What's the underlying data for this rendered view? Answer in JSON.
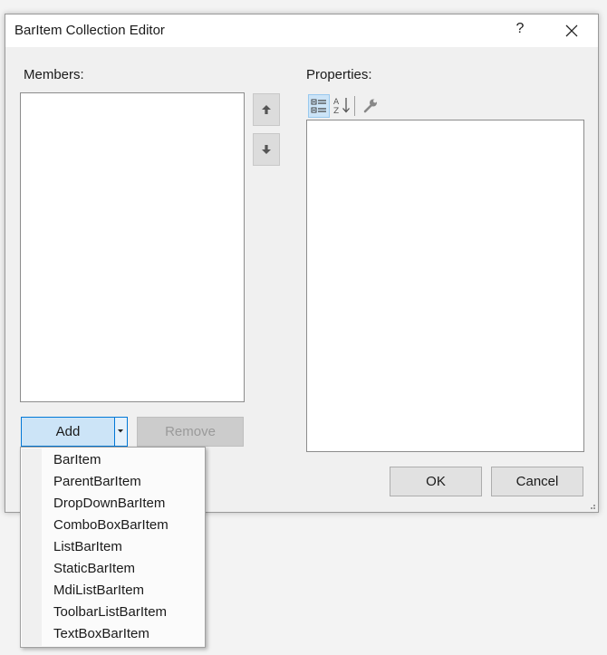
{
  "window": {
    "title": "BarItem Collection Editor",
    "help": "?",
    "close_icon": "close-icon"
  },
  "members": {
    "label": "Members:",
    "items": []
  },
  "properties": {
    "label": "Properties:"
  },
  "toolbar": {
    "buttons": [
      {
        "icon": "categorized-icon",
        "active": true
      },
      {
        "icon": "alphabetical-icon",
        "active": false
      },
      {
        "icon": "wrench-icon",
        "active": false
      }
    ]
  },
  "buttons": {
    "add": "Add",
    "remove": "Remove",
    "ok": "OK",
    "cancel": "Cancel"
  },
  "add_menu": {
    "items": [
      "BarItem",
      "ParentBarItem",
      "DropDownBarItem",
      "ComboBoxBarItem",
      "ListBarItem",
      "StaticBarItem",
      "MdiListBarItem",
      "ToolbarListBarItem",
      "TextBoxBarItem"
    ]
  },
  "colors": {
    "accent": "#0078d7",
    "selection": "#cce4f7"
  }
}
